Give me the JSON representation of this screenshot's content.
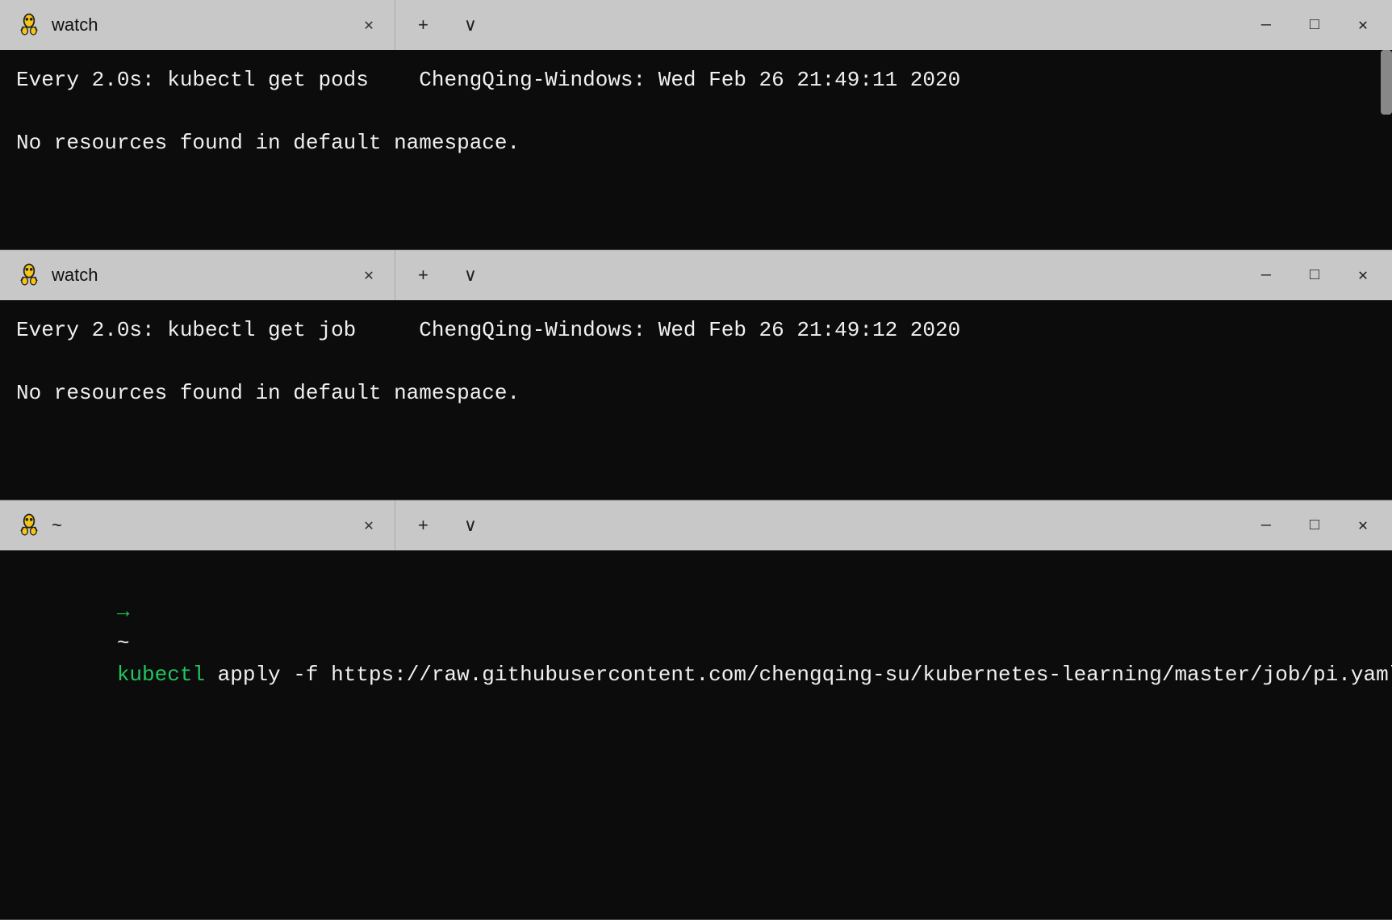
{
  "panes": [
    {
      "id": "pane-top",
      "tab_title": "watch",
      "status_line": "Every 2.0s: kubectl get pods    ChengQing-Windows: Wed Feb 26 21:49:11 2020",
      "blank1": "",
      "output_line": "No resources found in default namespace.",
      "has_scrollbar": true
    },
    {
      "id": "pane-mid",
      "tab_title": "watch",
      "status_line": "Every 2.0s: kubectl get job     ChengQing-Windows: Wed Feb 26 21:49:12 2020",
      "blank1": "",
      "output_line": "No resources found in default namespace.",
      "has_scrollbar": false
    },
    {
      "id": "pane-bot",
      "tab_title": "~",
      "prompt_arrow": "→",
      "prompt_tilde": "~",
      "prompt_cmd": "kubectl",
      "prompt_rest": " apply -f https://raw.githubusercontent.com/chengqing-su/kubernetes-learning/master/job/pi.yaml",
      "has_scrollbar": false
    }
  ],
  "titlebar": {
    "add_label": "+",
    "chevron_label": "∨",
    "minimize_label": "—",
    "maximize_label": "□",
    "close_label": "✕"
  }
}
